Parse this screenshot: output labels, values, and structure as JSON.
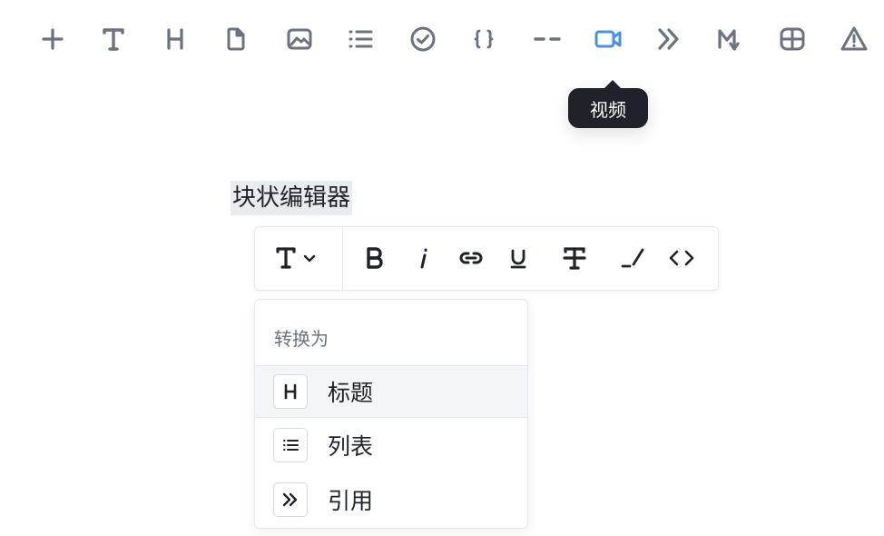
{
  "top_toolbar": {
    "tools": [
      {
        "name": "plus-icon"
      },
      {
        "name": "text-icon"
      },
      {
        "name": "heading-icon"
      },
      {
        "name": "file-icon"
      },
      {
        "name": "image-icon"
      },
      {
        "name": "list-icon"
      },
      {
        "name": "checklist-icon"
      },
      {
        "name": "code-braces-icon"
      },
      {
        "name": "divider-icon"
      },
      {
        "name": "video-icon",
        "active": true
      },
      {
        "name": "quote-icon"
      },
      {
        "name": "markdown-icon"
      },
      {
        "name": "table-icon"
      },
      {
        "name": "warning-icon"
      }
    ],
    "tooltip": "视频",
    "active_color": "#4a90e2",
    "icon_color": "#6b7280"
  },
  "editor": {
    "selected_text": "块状编辑器"
  },
  "inline_toolbar": {
    "buttons": [
      {
        "name": "text-type-dropdown"
      },
      {
        "name": "bold-icon"
      },
      {
        "name": "italic-icon"
      },
      {
        "name": "link-icon"
      },
      {
        "name": "underline-icon"
      },
      {
        "name": "strikethrough-icon"
      },
      {
        "name": "marker-icon"
      },
      {
        "name": "inline-code-icon"
      }
    ]
  },
  "convert_menu": {
    "title": "转换为",
    "items": [
      {
        "label": "标题",
        "icon": "heading-icon",
        "highlighted": true
      },
      {
        "label": "列表",
        "icon": "list-icon"
      },
      {
        "label": "引用",
        "icon": "quote-icon"
      }
    ]
  }
}
